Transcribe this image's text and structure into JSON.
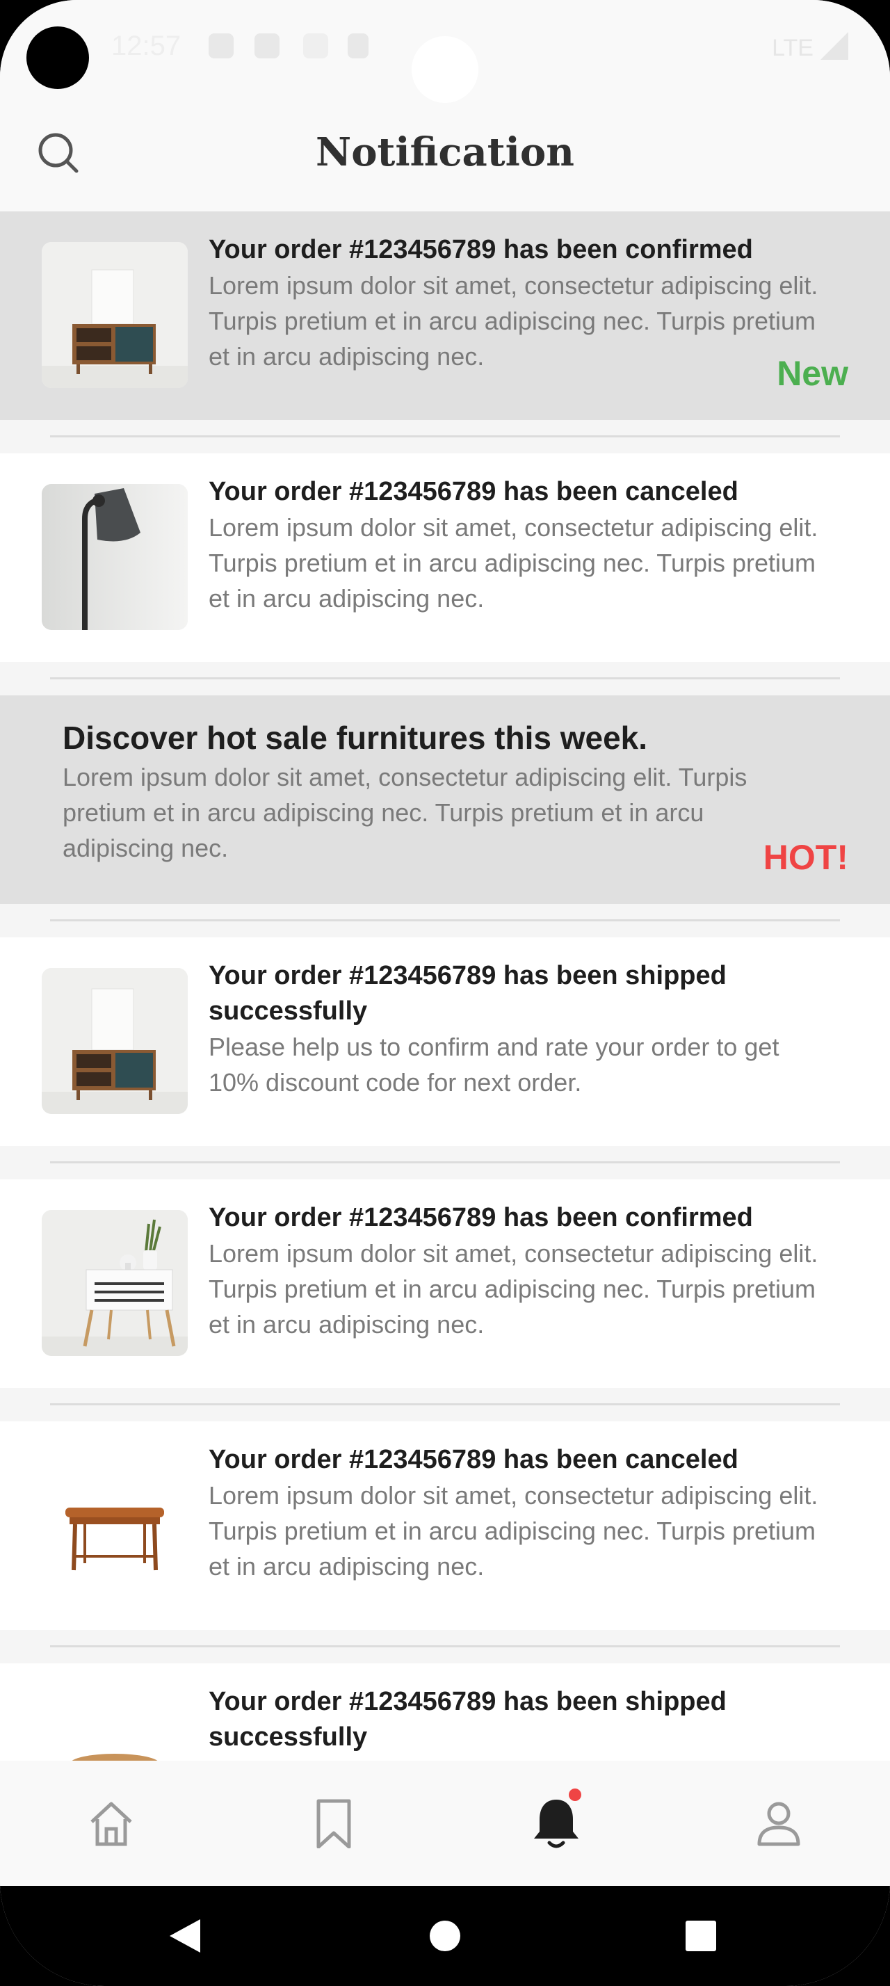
{
  "status_bar": {
    "time": "12:57",
    "network": "LTE"
  },
  "header": {
    "title": "Notification"
  },
  "notifications": [
    {
      "title": "Your order #123456789 has been confirmed",
      "body": "Lorem ipsum dolor sit amet, consectetur adipiscing elit. Turpis pretium et in arcu adipiscing nec. Turpis pretium et in arcu adipiscing nec.",
      "badge": "New",
      "image": "sideboard-cabinet"
    },
    {
      "title": "Your order #123456789 has been canceled",
      "body": "Lorem ipsum dolor sit amet, consectetur adipiscing elit. Turpis pretium et in arcu adipiscing nec. Turpis pretium et in arcu adipiscing nec.",
      "image": "floor-lamp"
    },
    {
      "title": "Discover hot sale furnitures this week.",
      "body": "Lorem ipsum dolor sit amet, consectetur adipiscing elit. Turpis pretium et in arcu adipiscing nec. Turpis pretium et in arcu adipiscing nec.",
      "badge": "HOT!"
    },
    {
      "title": "Your order #123456789 has been shipped successfully",
      "body": "Please help us to confirm and rate your order to get 10% discount code for next order.",
      "image": "sideboard-cabinet"
    },
    {
      "title": "Your order #123456789 has been confirmed",
      "body": "Lorem ipsum dolor sit amet, consectetur adipiscing elit. Turpis pretium et in arcu adipiscing nec. Turpis pretium et in arcu adipiscing nec.",
      "image": "nightstand"
    },
    {
      "title": "Your order #123456789 has been canceled",
      "body": "Lorem ipsum dolor sit amet, consectetur adipiscing elit. Turpis pretium et in arcu adipiscing nec. Turpis pretium et in arcu adipiscing nec.",
      "image": "wooden-table"
    },
    {
      "title": "Your order #123456789 has been shipped successfully",
      "image": "round-table"
    }
  ],
  "bottom_nav": {
    "items": [
      "home-icon",
      "bookmark-icon",
      "bell-icon",
      "profile-icon"
    ],
    "active": "bell-icon"
  },
  "colors": {
    "new_badge": "#4caf50",
    "hot_badge": "#ef4444",
    "highlight": "#e0e0e0"
  }
}
